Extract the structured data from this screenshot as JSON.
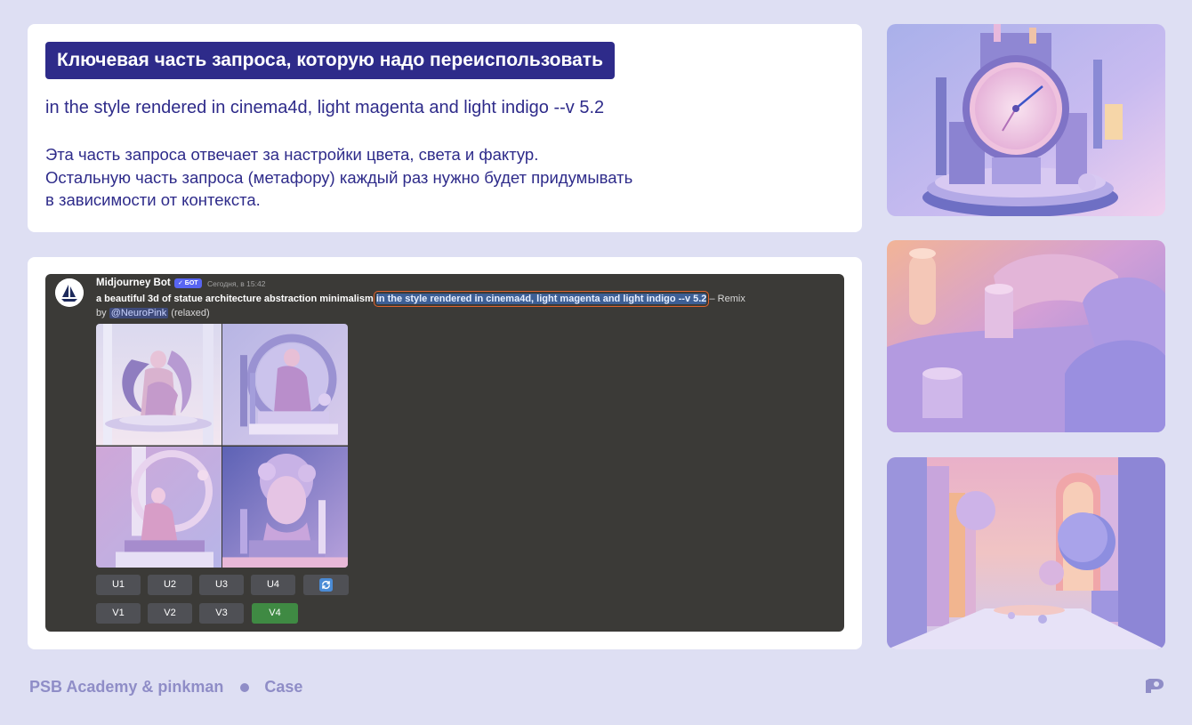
{
  "top_card": {
    "title": "Ключевая часть запроса, которую надо переиспользовать",
    "prompt_key": "in the style rendered in cinema4d, light magenta and light indigo --v 5.2",
    "description_lines": [
      "Эта часть запроса отвечает за настройки цвета, света и фактур.",
      "Остальную часть запроса (метафору) каждый раз нужно будет придумывать",
      "в зависимости от контекста."
    ]
  },
  "discord": {
    "bot_name": "Midjourney Bot",
    "bot_badge": "✓ БОТ",
    "timestamp": "Сегодня, в 15:42",
    "prompt_prefix": "a beautiful 3d of statue architecture abstraction minimalism",
    "prompt_highlight": "in the style rendered in cinema4d, light magenta and light indigo --v 5.2",
    "prompt_suffix": "– Remix",
    "by_label": "by",
    "mention": "@NeuroPink",
    "mode": "(relaxed)",
    "upscale_buttons": [
      "U1",
      "U2",
      "U3",
      "U4"
    ],
    "variation_buttons": [
      "V1",
      "V2",
      "V3",
      "V4"
    ],
    "active_button": "V4",
    "refresh_icon": "refresh-icon",
    "accent_colors": {
      "highlight_bg": "#3d5f95",
      "highlight_border": "#e0632e",
      "active_button": "#3f8a43"
    }
  },
  "side_images": [
    {
      "icon": "clock-sculpture-image"
    },
    {
      "icon": "abstract-shapes-image"
    },
    {
      "icon": "corridor-spheres-image"
    }
  ],
  "footer": {
    "brand": "PSB Academy & pinkman",
    "section": "Case",
    "logo": "pinkman-logo-icon"
  },
  "colors": {
    "background": "#dedff3",
    "primary": "#2e2b8a",
    "footer_text": "#8f8dc7"
  }
}
